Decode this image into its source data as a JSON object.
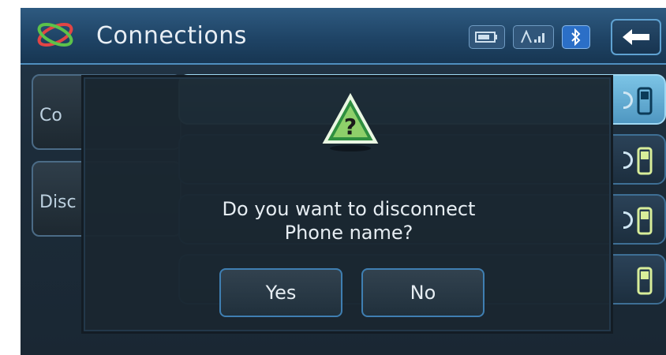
{
  "header": {
    "title": "Connections",
    "status_icons": [
      "battery-icon",
      "signal-icon",
      "bluetooth-icon"
    ],
    "back_icon": "arrow-left-icon"
  },
  "background": {
    "side_buttons": [
      "Co",
      "Disc"
    ],
    "list_rows": 4
  },
  "dialog": {
    "icon": "warning-question-icon",
    "message_line1": "Do you want to disconnect",
    "message_line2": "Phone name?",
    "yes_label": "Yes",
    "no_label": "No"
  },
  "colors": {
    "header_bg": "#1f4466",
    "accent": "#4f8fbf",
    "dialog_bg": "#1a2630",
    "text": "#e6edf2"
  }
}
